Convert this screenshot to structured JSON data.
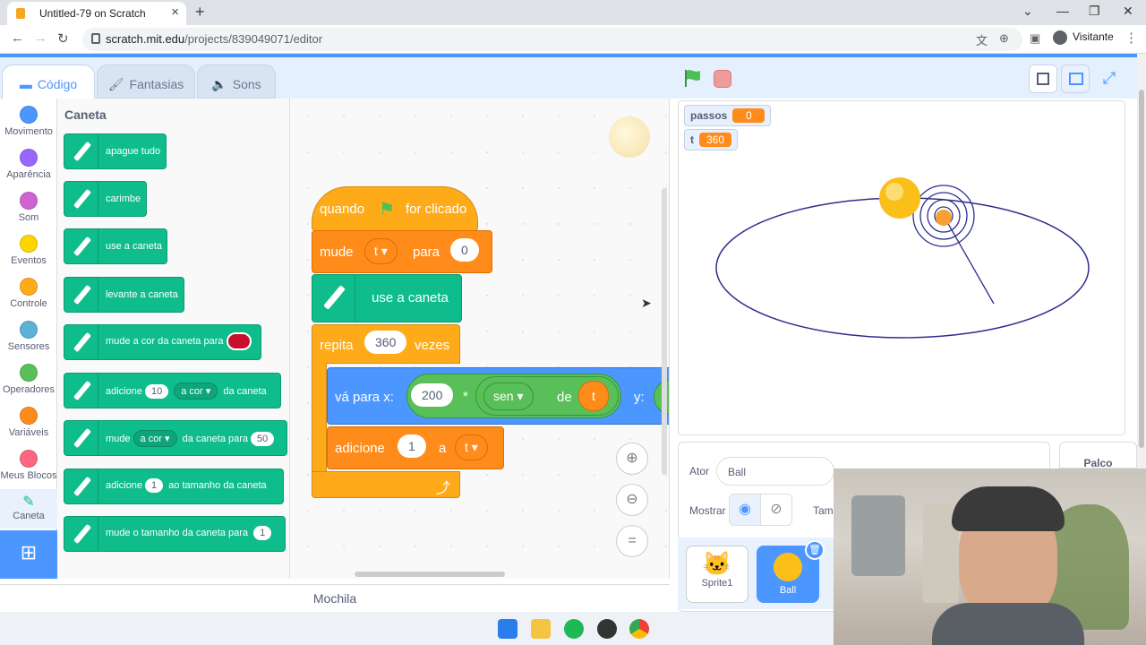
{
  "browser": {
    "tab_title": "Untitled-79 on Scratch",
    "url_domain": "scratch.mit.edu",
    "url_path": "/projects/839049071/editor",
    "profile": "Visitante"
  },
  "editor_tabs": {
    "code": "Código",
    "costumes": "Fantasias",
    "sounds": "Sons"
  },
  "categories": [
    {
      "label": "Movimento",
      "color": "#4c97ff"
    },
    {
      "label": "Aparência",
      "color": "#9966ff"
    },
    {
      "label": "Som",
      "color": "#cf63cf"
    },
    {
      "label": "Eventos",
      "color": "#ffd500"
    },
    {
      "label": "Controle",
      "color": "#ffab19"
    },
    {
      "label": "Sensores",
      "color": "#5cb1d6"
    },
    {
      "label": "Operadores",
      "color": "#59c059"
    },
    {
      "label": "Variáveis",
      "color": "#ff8c1a"
    },
    {
      "label": "Meus Blocos",
      "color": "#ff6680"
    },
    {
      "label": "Caneta",
      "color": "#0fbd8c"
    }
  ],
  "palette": {
    "title": "Caneta",
    "blocks": {
      "erase": "apague tudo",
      "stamp": "carimbe",
      "pen_down": "use a caneta",
      "pen_up": "levante a caneta",
      "set_color": "mude a cor da caneta para",
      "change_prefix": "adicione",
      "change_value": "10",
      "change_param": "a cor",
      "change_suffix": "da caneta",
      "set_prefix": "mude",
      "set_param": "a cor",
      "set_middle": "da caneta para",
      "set_value": "50",
      "size_change_prefix": "adicione",
      "size_change_value": "1",
      "size_change_suffix": "ao tamanho da caneta",
      "size_set": "mude o tamanho da caneta para",
      "size_set_value": "1"
    }
  },
  "script": {
    "hat_when": "quando",
    "hat_clicked": "for clicado",
    "set_var_prefix": "mude",
    "set_var_name": "t",
    "set_var_to": "para",
    "set_var_value": "0",
    "pen_down": "use a caneta",
    "repeat_prefix": "repita",
    "repeat_count": "360",
    "repeat_suffix": "vezes",
    "goto_prefix": "vá para x:",
    "goto_x_num": "200",
    "goto_times": "*",
    "goto_func": "sen",
    "goto_of": "de",
    "goto_var": "t",
    "goto_y": "y:",
    "change_prefix": "adicione",
    "change_value": "1",
    "change_to": "a",
    "change_var": "t",
    "zoom_reset": "="
  },
  "mochila": "Mochila",
  "monitors": [
    {
      "name": "passos",
      "value": "0"
    },
    {
      "name": "t",
      "value": "360"
    }
  ],
  "sprite_info": {
    "actor_label": "Ator",
    "actor_name": "Ball",
    "show_label": "Mostrar",
    "size_label": "Tama"
  },
  "sprites": [
    {
      "name": "Sprite1"
    },
    {
      "name": "Ball"
    }
  ],
  "stage_label": "Palco",
  "colors": {
    "accent": "#4c97ff",
    "pen": "#0fbd8c",
    "variables": "#ff8c1a",
    "control": "#ffab19"
  }
}
